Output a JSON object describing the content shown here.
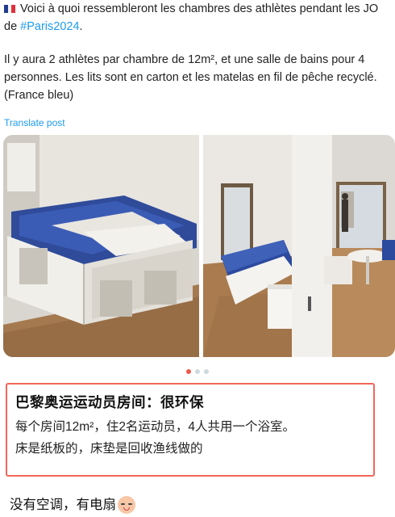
{
  "post": {
    "line1_text": "Voici à quoi ressembleront les chambres des athlètes pendant les JO de ",
    "line1_hashtag": "#Paris2024",
    "line1_end": ".",
    "paragraph2": "Il y aura 2 athlètes par chambre de 12m², et une salle de bains pour 4 personnes. Les lits sont en carton et les matelas en fil de pêche recyclé. (France bleu)",
    "translate_label": "Translate post",
    "flag_icon": "france-flag-icon"
  },
  "media": {
    "carousel_count": 3,
    "active_index": 0,
    "colors": {
      "active_dot": "#f4574b",
      "inactive_dot": "#cfd9de",
      "hashtag": "#1d9bf0"
    }
  },
  "caption": {
    "title": "巴黎奥运运动员房间：很环保",
    "line1": "每个房间12m²，住2名运动员，4人共用一个浴室。",
    "line2": "床是纸板的，床垫是回收渔线做的",
    "border_color": "#f2665a"
  },
  "footer": {
    "text": "没有空调，有电扇",
    "emoji_icon": "grinning-face-icon"
  }
}
